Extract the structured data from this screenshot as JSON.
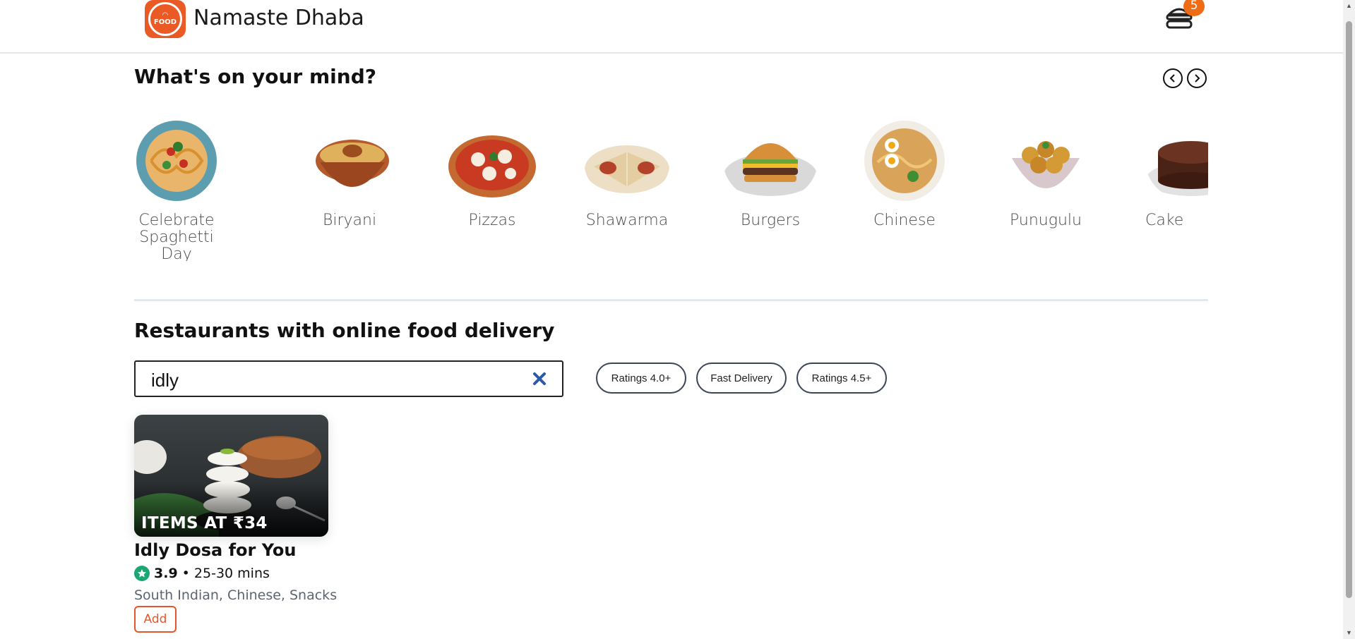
{
  "header": {
    "brand": "Namaste Dhaba",
    "logo_text": "FOOD",
    "cart_count": "5"
  },
  "mind": {
    "title": "What's on your mind?",
    "categories": [
      {
        "label": "Celebrate Spaghetti Day",
        "icon": "spaghetti-plate"
      },
      {
        "label": "Biryani",
        "icon": "biryani-pot"
      },
      {
        "label": "Pizzas",
        "icon": "pizza"
      },
      {
        "label": "Shawarma",
        "icon": "shawarma-wrap"
      },
      {
        "label": "Burgers",
        "icon": "burger"
      },
      {
        "label": "Chinese",
        "icon": "noodle-bowl"
      },
      {
        "label": "Punugulu",
        "icon": "punugulu-bowl"
      },
      {
        "label": "Cake",
        "icon": "chocolate-cake"
      }
    ]
  },
  "restaurants": {
    "title": "Restaurants with online food delivery",
    "search_value": "idly",
    "filters": [
      "Ratings 4.0+",
      "Fast Delivery",
      "Ratings 4.5+"
    ],
    "cards": [
      {
        "offer": "ITEMS AT ₹34",
        "name": "Idly Dosa for You",
        "rating": "3.9",
        "delivery": "• 25-30 mins",
        "cuisines": "South Indian, Chinese, Snacks",
        "add_label": "Add"
      }
    ]
  },
  "colors": {
    "accent": "#ea5a24",
    "rating_green": "#1ba672",
    "badge": "#ef6c16"
  }
}
